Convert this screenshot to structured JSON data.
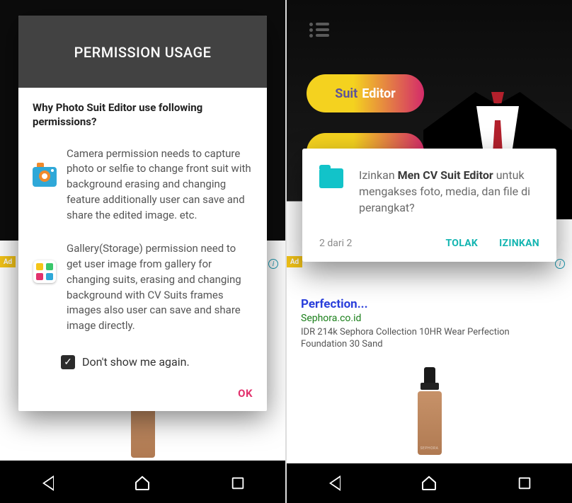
{
  "left": {
    "dialog": {
      "title": "PERMISSION USAGE",
      "question": "Why Photo Suit Editor use following permissions?",
      "camera_text": "Camera permission needs to capture photo or selfie to change front suit with background erasing and changing feature additionally user can save and share the edited image. etc.",
      "gallery_text": "Gallery(Storage) permission need to get user image from gallery for changing suits, erasing and changing background with CV Suits frames images also user can save and share image directly.",
      "checkbox_label": "Don't show me again.",
      "ok_label": "OK"
    },
    "ad_badge": "Ad"
  },
  "right": {
    "suit_btn_w1": "Suit",
    "suit_btn_w2": "Editor",
    "dialog": {
      "text_pre": "Izinkan ",
      "app_name": "Men CV Suit Editor",
      "text_post": " untuk mengakses foto, media, dan file di perangkat?",
      "count": "2 dari 2",
      "deny": "TOLAK",
      "allow": "IZINKAN"
    },
    "ad": {
      "badge": "Ad",
      "title": "Perfection...",
      "domain": "Sephora.co.id",
      "desc": "IDR 214k Sephora Collection 10HR Wear Perfection Foundation 30 Sand",
      "product_label": "SEPHORA"
    }
  }
}
